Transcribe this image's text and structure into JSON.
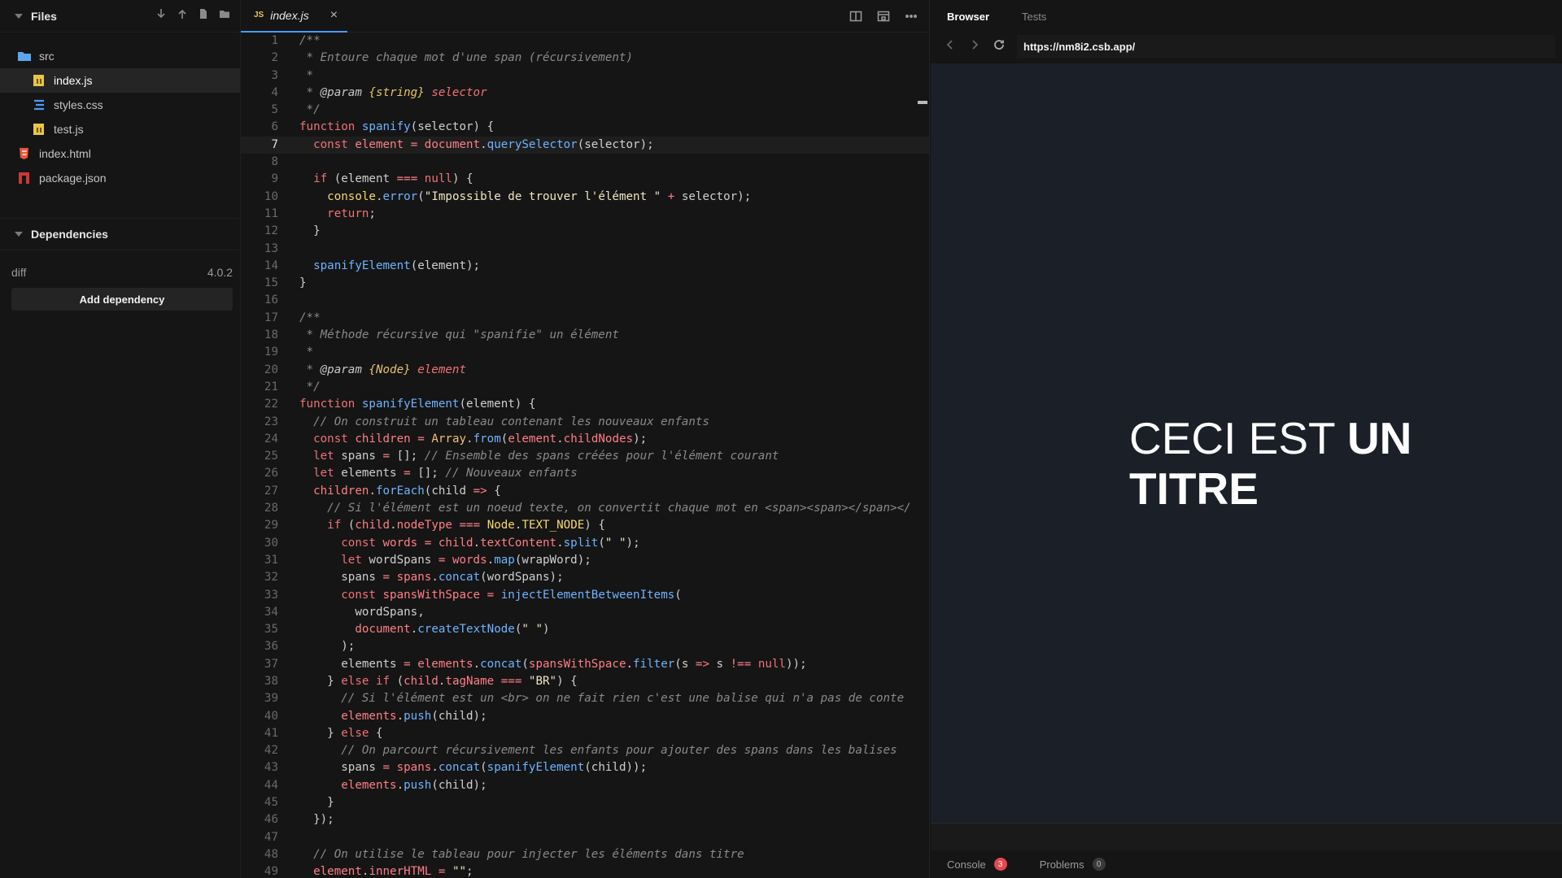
{
  "sidebar": {
    "files_title": "Files",
    "tree": [
      {
        "label": "src",
        "type": "folder"
      },
      {
        "label": "index.js",
        "type": "js"
      },
      {
        "label": "styles.css",
        "type": "css"
      },
      {
        "label": "test.js",
        "type": "js"
      },
      {
        "label": "index.html",
        "type": "html"
      },
      {
        "label": "package.json",
        "type": "json"
      }
    ],
    "dependencies_title": "Dependencies",
    "dependencies": [
      {
        "name": "diff",
        "version": "4.0.2"
      }
    ],
    "add_dependency_label": "Add dependency"
  },
  "editor": {
    "tab_badge": "JS",
    "tab_label": "index.js",
    "tab_close": "×",
    "current_line": 7
  },
  "browser": {
    "tabs": [
      "Browser",
      "Tests"
    ],
    "url": "https://nm8i2.csb.app/",
    "heading_normal": "CECI EST ",
    "heading_bold_1": "UN",
    "heading_bold_2": "TITRE",
    "bottom_tabs": [
      {
        "label": "Console",
        "count": "3"
      },
      {
        "label": "Problems",
        "count": "0"
      }
    ]
  },
  "colors": {
    "accent": "#4b9aff",
    "preview_bg": "#1b1f27",
    "error_badge": "#e5484d"
  },
  "code_lines": [
    [
      [
        "c",
        "/**"
      ]
    ],
    [
      [
        "c",
        " * Entoure chaque mot d'une span (récursivement)"
      ]
    ],
    [
      [
        "c",
        " *"
      ]
    ],
    [
      [
        "c",
        " * "
      ],
      [
        "cd",
        "@param"
      ],
      [
        "c",
        " "
      ],
      [
        "ty",
        "{string}"
      ],
      [
        "c",
        " "
      ],
      [
        "pn",
        "selector"
      ]
    ],
    [
      [
        "c",
        " */"
      ]
    ],
    [
      [
        "k",
        "function "
      ],
      [
        "fn",
        "spanify"
      ],
      [
        "p",
        "(selector) {"
      ]
    ],
    [
      [
        "p",
        "  "
      ],
      [
        "k",
        "const "
      ],
      [
        "o",
        "element"
      ],
      [
        "p",
        " "
      ],
      [
        "o",
        "="
      ],
      [
        "p",
        " "
      ],
      [
        "o",
        "document"
      ],
      [
        "p",
        "."
      ],
      [
        "fn",
        "querySelector"
      ],
      [
        "p",
        "(selector);"
      ]
    ],
    [],
    [
      [
        "p",
        "  "
      ],
      [
        "k",
        "if"
      ],
      [
        "p",
        " (element "
      ],
      [
        "o",
        "==="
      ],
      [
        "p",
        " "
      ],
      [
        "k",
        "null"
      ],
      [
        "p",
        ") {"
      ]
    ],
    [
      [
        "p",
        "    "
      ],
      [
        "pr",
        "console"
      ],
      [
        "p",
        "."
      ],
      [
        "fn",
        "error"
      ],
      [
        "p",
        "("
      ],
      [
        "s",
        "\"Impossible de trouver l'élément \""
      ],
      [
        "p",
        " "
      ],
      [
        "o",
        "+"
      ],
      [
        "p",
        " selector);"
      ]
    ],
    [
      [
        "p",
        "    "
      ],
      [
        "k",
        "return"
      ],
      [
        "p",
        ";"
      ]
    ],
    [
      [
        "p",
        "  }"
      ]
    ],
    [],
    [
      [
        "p",
        "  "
      ],
      [
        "fn",
        "spanifyElement"
      ],
      [
        "p",
        "(element);"
      ]
    ],
    [
      [
        "p",
        "}"
      ]
    ],
    [],
    [
      [
        "c",
        "/**"
      ]
    ],
    [
      [
        "c",
        " * Méthode récursive qui \"spanifie\" un élément"
      ]
    ],
    [
      [
        "c",
        " *"
      ]
    ],
    [
      [
        "c",
        " * "
      ],
      [
        "cd",
        "@param"
      ],
      [
        "c",
        " "
      ],
      [
        "ty",
        "{Node}"
      ],
      [
        "c",
        " "
      ],
      [
        "pn",
        "element"
      ]
    ],
    [
      [
        "c",
        " */"
      ]
    ],
    [
      [
        "k",
        "function "
      ],
      [
        "fn",
        "spanifyElement"
      ],
      [
        "p",
        "(element) {"
      ]
    ],
    [
      [
        "p",
        "  "
      ],
      [
        "c",
        "// On construit un tableau contenant les nouveaux enfants"
      ]
    ],
    [
      [
        "p",
        "  "
      ],
      [
        "k",
        "const "
      ],
      [
        "o",
        "children"
      ],
      [
        "p",
        " "
      ],
      [
        "o",
        "="
      ],
      [
        "p",
        " "
      ],
      [
        "cls",
        "Array"
      ],
      [
        "p",
        "."
      ],
      [
        "fn",
        "from"
      ],
      [
        "p",
        "("
      ],
      [
        "o",
        "element"
      ],
      [
        "p",
        "."
      ],
      [
        "o",
        "childNodes"
      ],
      [
        "p",
        ");"
      ]
    ],
    [
      [
        "p",
        "  "
      ],
      [
        "k",
        "let"
      ],
      [
        "p",
        " spans "
      ],
      [
        "o",
        "="
      ],
      [
        "p",
        " []; "
      ],
      [
        "c",
        "// Ensemble des spans créées pour l'élément courant"
      ]
    ],
    [
      [
        "p",
        "  "
      ],
      [
        "k",
        "let"
      ],
      [
        "p",
        " elements "
      ],
      [
        "o",
        "="
      ],
      [
        "p",
        " []; "
      ],
      [
        "c",
        "// Nouveaux enfants"
      ]
    ],
    [
      [
        "p",
        "  "
      ],
      [
        "o",
        "children"
      ],
      [
        "p",
        "."
      ],
      [
        "fn",
        "forEach"
      ],
      [
        "p",
        "(child "
      ],
      [
        "o",
        "=>"
      ],
      [
        "p",
        " {"
      ]
    ],
    [
      [
        "p",
        "    "
      ],
      [
        "c",
        "// Si l'élément est un noeud texte, on convertit chaque mot en <span><span></span></"
      ]
    ],
    [
      [
        "p",
        "    "
      ],
      [
        "k",
        "if"
      ],
      [
        "p",
        " ("
      ],
      [
        "o",
        "child"
      ],
      [
        "p",
        "."
      ],
      [
        "o",
        "nodeType"
      ],
      [
        "p",
        " "
      ],
      [
        "o",
        "==="
      ],
      [
        "p",
        " "
      ],
      [
        "pr",
        "Node"
      ],
      [
        "p",
        "."
      ],
      [
        "pr",
        "TEXT_NODE"
      ],
      [
        "p",
        ") {"
      ]
    ],
    [
      [
        "p",
        "      "
      ],
      [
        "k",
        "const "
      ],
      [
        "o",
        "words"
      ],
      [
        "p",
        " "
      ],
      [
        "o",
        "="
      ],
      [
        "p",
        " "
      ],
      [
        "o",
        "child"
      ],
      [
        "p",
        "."
      ],
      [
        "o",
        "textContent"
      ],
      [
        "p",
        "."
      ],
      [
        "fn",
        "split"
      ],
      [
        "p",
        "("
      ],
      [
        "s",
        "\" \""
      ],
      [
        "p",
        ");"
      ]
    ],
    [
      [
        "p",
        "      "
      ],
      [
        "k",
        "let"
      ],
      [
        "p",
        " wordSpans "
      ],
      [
        "o",
        "="
      ],
      [
        "p",
        " "
      ],
      [
        "o",
        "words"
      ],
      [
        "p",
        "."
      ],
      [
        "fn",
        "map"
      ],
      [
        "p",
        "(wrapWord);"
      ]
    ],
    [
      [
        "p",
        "      spans "
      ],
      [
        "o",
        "="
      ],
      [
        "p",
        " "
      ],
      [
        "o",
        "spans"
      ],
      [
        "p",
        "."
      ],
      [
        "fn",
        "concat"
      ],
      [
        "p",
        "(wordSpans);"
      ]
    ],
    [
      [
        "p",
        "      "
      ],
      [
        "k",
        "const "
      ],
      [
        "o",
        "spansWithSpace"
      ],
      [
        "p",
        " "
      ],
      [
        "o",
        "="
      ],
      [
        "p",
        " "
      ],
      [
        "fn",
        "injectElementBetweenItems"
      ],
      [
        "p",
        "("
      ]
    ],
    [
      [
        "p",
        "        wordSpans,"
      ]
    ],
    [
      [
        "p",
        "        "
      ],
      [
        "o",
        "document"
      ],
      [
        "p",
        "."
      ],
      [
        "fn",
        "createTextNode"
      ],
      [
        "p",
        "("
      ],
      [
        "s",
        "\" \""
      ],
      [
        "p",
        ")"
      ]
    ],
    [
      [
        "p",
        "      );"
      ]
    ],
    [
      [
        "p",
        "      elements "
      ],
      [
        "o",
        "="
      ],
      [
        "p",
        " "
      ],
      [
        "o",
        "elements"
      ],
      [
        "p",
        "."
      ],
      [
        "fn",
        "concat"
      ],
      [
        "p",
        "("
      ],
      [
        "o",
        "spansWithSpace"
      ],
      [
        "p",
        "."
      ],
      [
        "fn",
        "filter"
      ],
      [
        "p",
        "(s "
      ],
      [
        "o",
        "=>"
      ],
      [
        "p",
        " s "
      ],
      [
        "o",
        "!=="
      ],
      [
        "p",
        " "
      ],
      [
        "k",
        "null"
      ],
      [
        "p",
        "));"
      ]
    ],
    [
      [
        "p",
        "    } "
      ],
      [
        "k",
        "else if"
      ],
      [
        "p",
        " ("
      ],
      [
        "o",
        "child"
      ],
      [
        "p",
        "."
      ],
      [
        "o",
        "tagName"
      ],
      [
        "p",
        " "
      ],
      [
        "o",
        "==="
      ],
      [
        "p",
        " "
      ],
      [
        "s",
        "\"BR\""
      ],
      [
        "p",
        ") {"
      ]
    ],
    [
      [
        "p",
        "      "
      ],
      [
        "c",
        "// Si l'élément est un <br> on ne fait rien c'est une balise qui n'a pas de conte"
      ]
    ],
    [
      [
        "p",
        "      "
      ],
      [
        "o",
        "elements"
      ],
      [
        "p",
        "."
      ],
      [
        "fn",
        "push"
      ],
      [
        "p",
        "(child);"
      ]
    ],
    [
      [
        "p",
        "    } "
      ],
      [
        "k",
        "else"
      ],
      [
        "p",
        " {"
      ]
    ],
    [
      [
        "p",
        "      "
      ],
      [
        "c",
        "// On parcourt récursivement les enfants pour ajouter des spans dans les balises"
      ]
    ],
    [
      [
        "p",
        "      spans "
      ],
      [
        "o",
        "="
      ],
      [
        "p",
        " "
      ],
      [
        "o",
        "spans"
      ],
      [
        "p",
        "."
      ],
      [
        "fn",
        "concat"
      ],
      [
        "p",
        "("
      ],
      [
        "fn",
        "spanifyElement"
      ],
      [
        "p",
        "(child));"
      ]
    ],
    [
      [
        "p",
        "      "
      ],
      [
        "o",
        "elements"
      ],
      [
        "p",
        "."
      ],
      [
        "fn",
        "push"
      ],
      [
        "p",
        "(child);"
      ]
    ],
    [
      [
        "p",
        "    }"
      ]
    ],
    [
      [
        "p",
        "  });"
      ]
    ],
    [],
    [
      [
        "p",
        "  "
      ],
      [
        "c",
        "// On utilise le tableau pour injecter les éléments dans titre"
      ]
    ],
    [
      [
        "p",
        "  "
      ],
      [
        "o",
        "element"
      ],
      [
        "p",
        "."
      ],
      [
        "o",
        "innerHTML"
      ],
      [
        "p",
        " "
      ],
      [
        "o",
        "="
      ],
      [
        "p",
        " "
      ],
      [
        "s",
        "\"\""
      ],
      [
        "p",
        ";"
      ]
    ]
  ]
}
